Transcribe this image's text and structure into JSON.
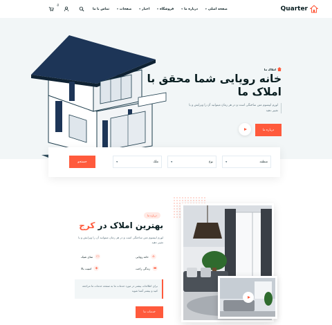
{
  "header": {
    "logo_text": "Quarter",
    "cart_count": "0",
    "nav": [
      {
        "label": "صفحه اصلی"
      },
      {
        "label": "درباره ما"
      },
      {
        "label": "فروشگاه"
      },
      {
        "label": "اخبار"
      },
      {
        "label": "صفحات"
      },
      {
        "label": "تماس با ما"
      }
    ]
  },
  "hero": {
    "tag": "املاک ما",
    "title": "خانه رویایی شما محقق با املاک ما",
    "text": "لورم ایپسوم متن ساختگی است و در هر زمان میتوانید آن را ویرایش و یا تغییر دهید",
    "button": "درباره ما"
  },
  "search": {
    "fields": [
      "منطقه",
      "نوع",
      "ملک"
    ],
    "button": "جستجو"
  },
  "about": {
    "tag": "درباره ما",
    "title_main": "بهترین املاک در ",
    "title_highlight": "کرج",
    "text": "لورم ایپسوم متن ساختگی است و در هر زمان میتوانید آن را ویرایش و یا تغییر دهید",
    "features": [
      "خانه رویایی",
      "تمای شیک",
      "زندگی راحت",
      "امنیت بالا"
    ],
    "quote": "برای اطلاعات بیشتر در مورد خدمات ما به صفحه خدمات ما مراجعه کنید و بیشتر آشنا شوید",
    "button": "خدمات ما"
  },
  "colors": {
    "accent": "#ff5a3c",
    "dark": "#071c1f",
    "light_bg": "#f2f6f7"
  }
}
